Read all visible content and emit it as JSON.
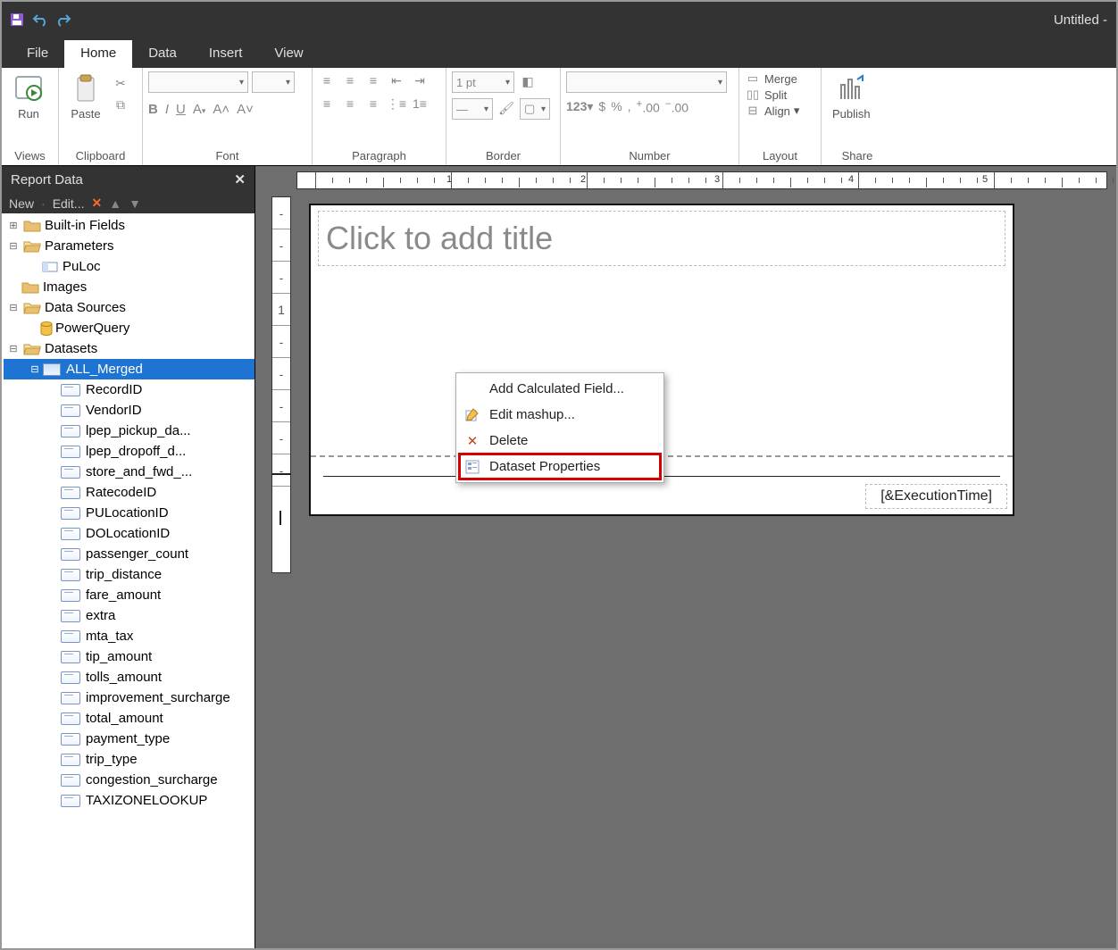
{
  "window": {
    "title": "Untitled -"
  },
  "qat": {
    "save": "save-icon",
    "undo": "undo-icon",
    "redo": "redo-icon"
  },
  "tabs": [
    "File",
    "Home",
    "Data",
    "Insert",
    "View"
  ],
  "active_tab": "Home",
  "ribbon": {
    "views": {
      "run": "Run",
      "label": "Views"
    },
    "clipboard": {
      "paste": "Paste",
      "label": "Clipboard"
    },
    "font": {
      "label": "Font",
      "bold": "B",
      "italic": "I",
      "underline": "U",
      "fontcolor": "A",
      "grow": "A˄",
      "shrink": "A˅"
    },
    "paragraph": {
      "label": "Paragraph"
    },
    "border": {
      "label": "Border",
      "weight": "1 pt"
    },
    "number": {
      "label": "Number",
      "fmt": "123",
      "currency": "$",
      "percent": "%",
      "thousand": ",",
      "inc": ".00",
      "dec": ".00"
    },
    "layout": {
      "label": "Layout",
      "merge": "Merge",
      "split": "Split",
      "align": "Align"
    },
    "share": {
      "label": "Share",
      "publish": "Publish"
    }
  },
  "panel": {
    "title": "Report Data",
    "new": "New",
    "edit": "Edit..."
  },
  "tree": {
    "builtin": "Built-in Fields",
    "parameters": "Parameters",
    "param_items": [
      "PuLoc"
    ],
    "images": "Images",
    "datasources": "Data Sources",
    "ds_items": [
      "PowerQuery"
    ],
    "datasets": "Datasets",
    "dataset_items": [
      {
        "name": "ALL_Merged",
        "fields": [
          "RecordID",
          "VendorID",
          "lpep_pickup_da...",
          "lpep_dropoff_d...",
          "store_and_fwd_...",
          "RatecodeID",
          "PULocationID",
          "DOLocationID",
          "passenger_count",
          "trip_distance",
          "fare_amount",
          "extra",
          "mta_tax",
          "tip_amount",
          "tolls_amount",
          "improvement_surcharge",
          "total_amount",
          "payment_type",
          "trip_type",
          "congestion_surcharge",
          "TAXIZONELOOKUP"
        ]
      }
    ]
  },
  "context_menu": {
    "items": [
      "Add Calculated Field...",
      "Edit mashup...",
      "Delete",
      "Dataset Properties"
    ],
    "highlighted": "Dataset Properties"
  },
  "canvas": {
    "title_placeholder": "Click to add title",
    "footer": "[&ExecutionTime]",
    "ruler_marks": [
      "1",
      "2",
      "3",
      "4",
      "5"
    ],
    "ruler_v": [
      "-",
      "-",
      "-",
      "1",
      "-",
      "-",
      "-",
      "-",
      "-"
    ]
  }
}
